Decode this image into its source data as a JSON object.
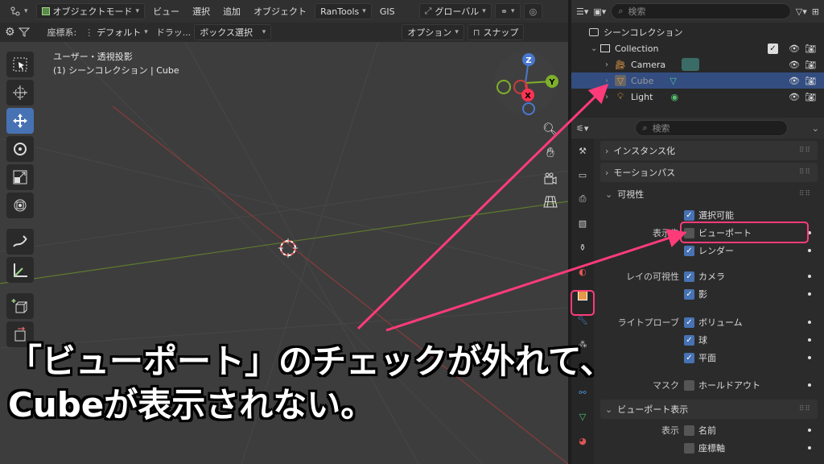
{
  "viewport_header": {
    "mode": "オブジェクトモード",
    "menus": [
      "ビュー",
      "選択",
      "追加",
      "オブジェクト"
    ],
    "addon": "RanTools",
    "gis": "GIS",
    "orientation": "グローバル"
  },
  "viewport_subheader": {
    "coord_label": "座標系:",
    "coord_value": "デフォルト",
    "drag_label": "ドラッ...",
    "drag_value": "ボックス選択",
    "options": "オプション",
    "snap": "スナップ"
  },
  "viewport": {
    "view_name": "ユーザー・透視投影",
    "collection_info": "(1) シーンコレクション | Cube"
  },
  "gizmo": {
    "z": "Z",
    "y": "Y",
    "x": "X"
  },
  "outliner": {
    "search_placeholder": "検索",
    "scene_collection": "シーンコレクション",
    "collection": "Collection",
    "items": [
      "Camera",
      "Cube",
      "Light"
    ]
  },
  "properties": {
    "search_placeholder": "検索",
    "panels": {
      "instancing": "インスタンス化",
      "motion_paths": "モーションパス",
      "visibility": "可視性",
      "viewport_display": "ビューポート表示"
    },
    "selectable": "選択可能",
    "show_in_label": "表示先",
    "viewport": "ビューポート",
    "render": "レンダー",
    "ray_visibility_label": "レイの可視性",
    "camera": "カメラ",
    "shadow": "影",
    "light_probes_label": "ライトプローブ",
    "volume": "ボリューム",
    "sphere": "球",
    "plane": "平面",
    "mask_label": "マスク",
    "holdout": "ホールドアウト",
    "show_label": "表示",
    "name": "名前",
    "axes": "座標軸"
  },
  "caption": {
    "line1": "「ビューポート」のチェックが外れて、",
    "line2": "Cubeが表示されない。"
  },
  "colors": {
    "accent": "#4772b3",
    "highlight": "#ff3b7a",
    "selection": "#334d80"
  }
}
